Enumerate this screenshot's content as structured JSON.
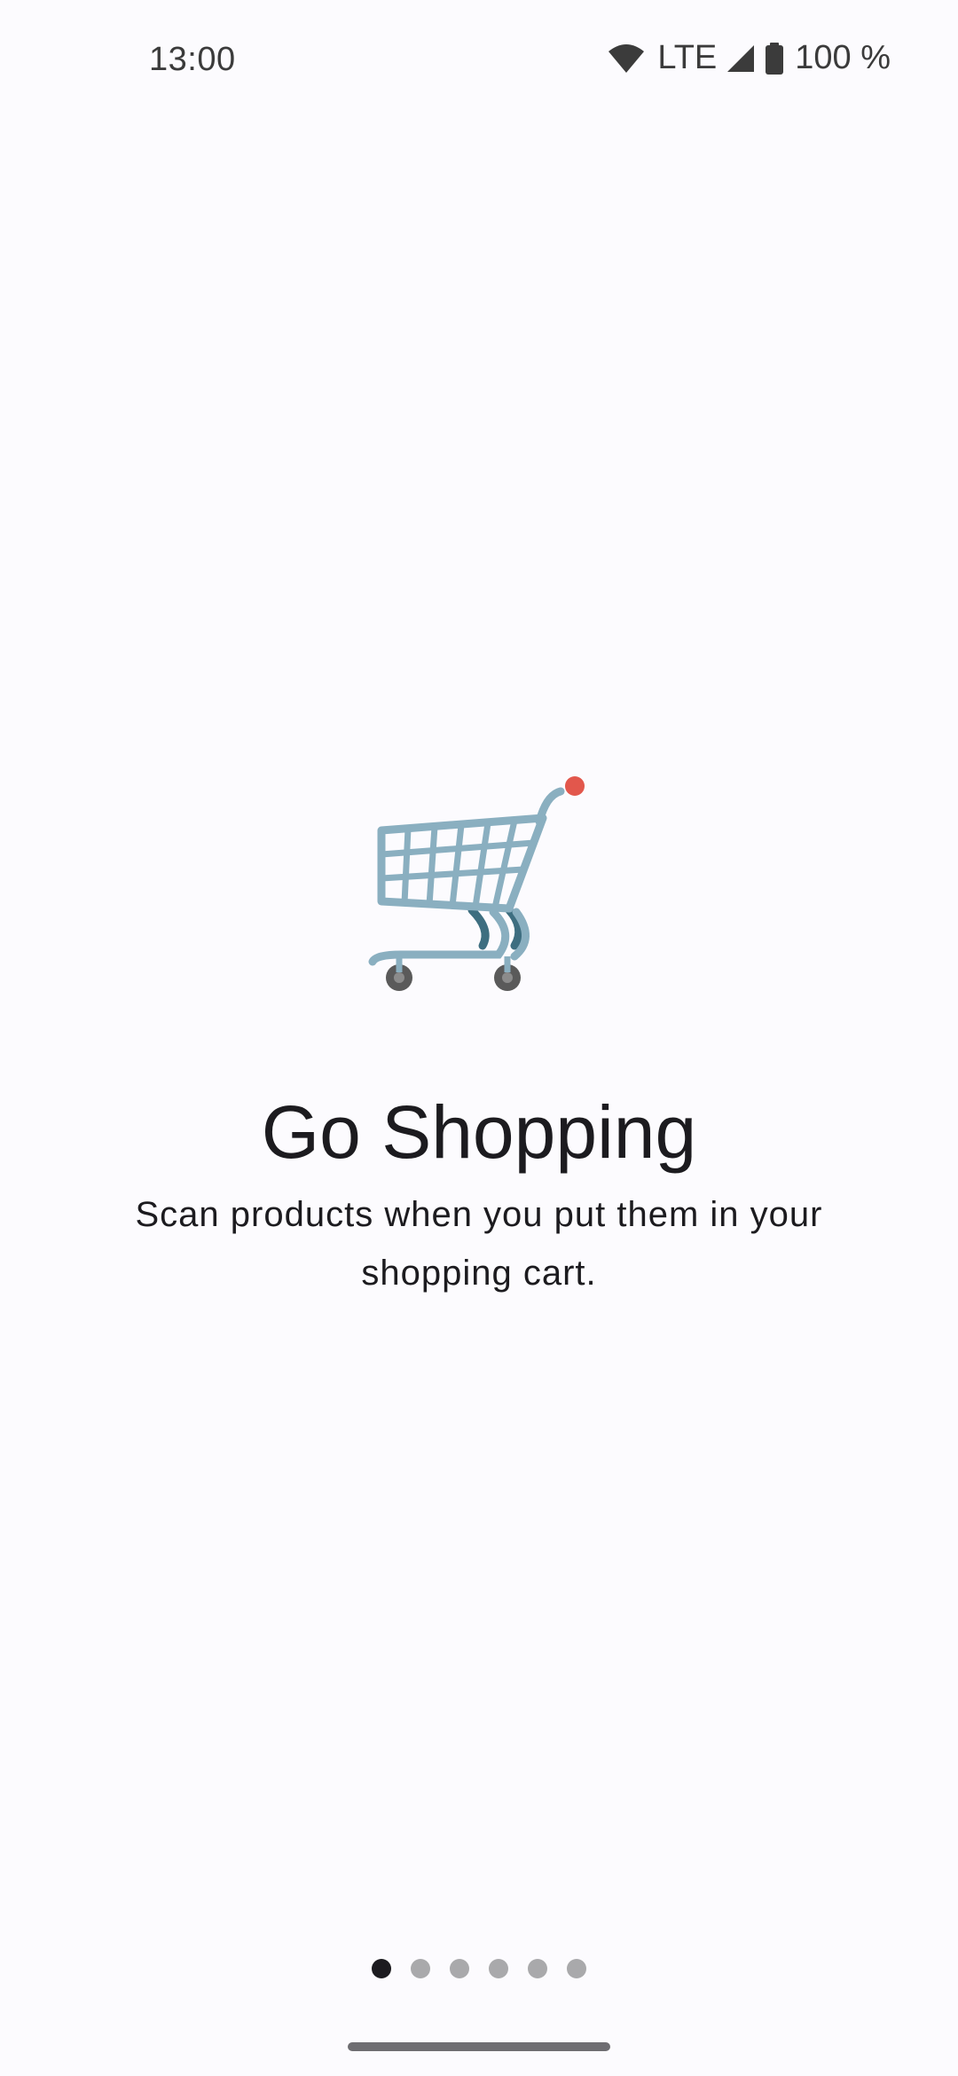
{
  "status_bar": {
    "time": "13:00",
    "network": "LTE",
    "battery": "100 %",
    "icons": [
      "wifi-icon",
      "cellular-signal-icon",
      "battery-icon"
    ]
  },
  "onboarding": {
    "illustration": "shopping-cart-icon",
    "title": "Go Shopping",
    "description": "Scan products when you put them in your shopping cart.",
    "page_count": 6,
    "current_page": 1
  },
  "colors": {
    "background": "#fcfbfe",
    "text": "#1c1b1f",
    "dot_active": "#1c1b1f",
    "dot_inactive": "#a9a9ab",
    "cart_frame": "#8aafc0",
    "cart_handle": "#e2574c"
  }
}
